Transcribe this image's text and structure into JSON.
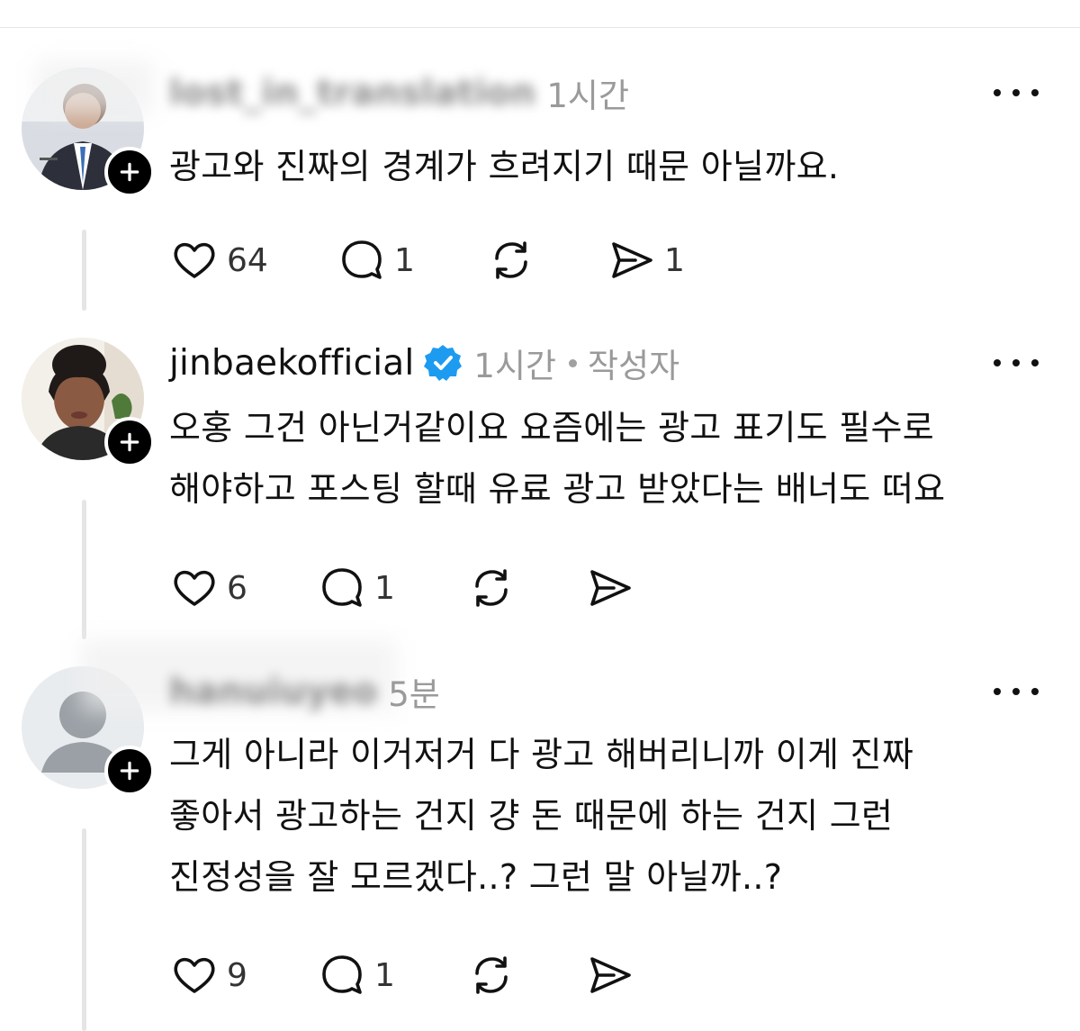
{
  "posts": [
    {
      "username": "lost_in_translation",
      "username_blurred": true,
      "time": "1시간",
      "verified": false,
      "author_tag": "",
      "text_lines": [
        "광고와 진짜의 경계가 흐려지기 때문 아닐까요."
      ],
      "likes": "64",
      "replies": "1",
      "reposts": "",
      "shares": "1",
      "avatar": "person-in-suit-avatar"
    },
    {
      "username": "jinbaekofficial",
      "username_blurred": false,
      "time": "1시간",
      "verified": true,
      "author_tag": "작성자",
      "text_lines": [
        "오홍 그건 아닌거같이요 요즘에는 광고 표기도 필수로",
        "해야하고 포스팅 할때 유료 광고 받았다는 배너도 떠요"
      ],
      "likes": "6",
      "replies": "1",
      "reposts": "",
      "shares": "",
      "avatar": "woman-profile-avatar"
    },
    {
      "username": "hanuiuyeo",
      "username_blurred": true,
      "time": "5분",
      "verified": false,
      "author_tag": "",
      "text_lines": [
        "그게 아니라 이거저거 다 광고 해버리니까 이게 진짜",
        "좋아서 광고하는 건지 걍 돈 때문에 하는 건지 그런",
        "진정성을 잘 모르겠다..? 그런 말 아닐까..?"
      ],
      "likes": "9",
      "replies": "1",
      "reposts": "",
      "shares": "",
      "avatar": "default-person-avatar"
    }
  ],
  "colors": {
    "accent_verified": "#1d9bf0",
    "muted_text": "#9a9a9a",
    "thread_line": "#e5e5e5"
  }
}
